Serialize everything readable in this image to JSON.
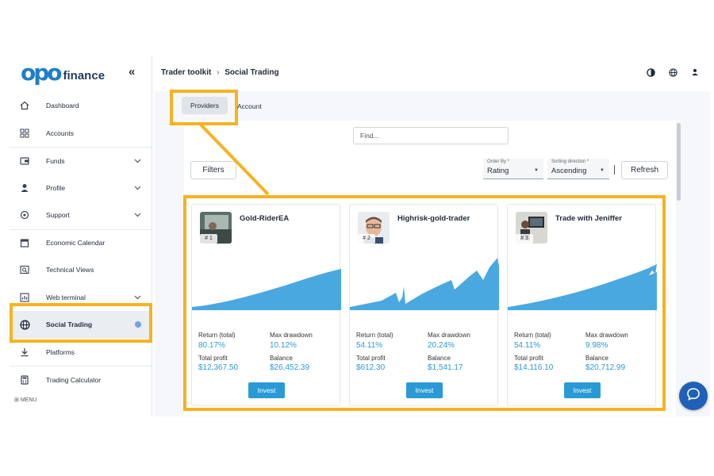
{
  "brand": {
    "mark": "opo",
    "text": "finance",
    "accent": "#1f7fc8",
    "highlight": "#f5b320"
  },
  "sidebar": {
    "items": [
      {
        "label": "Dashboard",
        "icon": "home-icon"
      },
      {
        "label": "Accounts",
        "icon": "grid-icon"
      },
      {
        "label": "Funds",
        "icon": "wallet-icon"
      },
      {
        "label": "Profile",
        "icon": "user-icon"
      },
      {
        "label": "Support",
        "icon": "support-icon"
      },
      {
        "label": "Economic Calendar",
        "icon": "calendar-icon"
      },
      {
        "label": "Technical Views",
        "icon": "search-chart-icon"
      },
      {
        "label": "Web terminal",
        "icon": "chart-icon"
      },
      {
        "label": "Social Trading",
        "icon": "globe-icon"
      },
      {
        "label": "Platforms",
        "icon": "download-icon"
      },
      {
        "label": "Trading Calculator",
        "icon": "calculator-icon"
      }
    ],
    "menu_label": "MENU"
  },
  "header": {
    "breadcrumb": [
      "Trader toolkit",
      "Social Trading"
    ]
  },
  "tabs": {
    "providers": "Providers",
    "account": "Account"
  },
  "toolbar": {
    "find_placeholder": "Find...",
    "filters": "Filters",
    "order_by_label": "Order By *",
    "order_by_value": "Rating",
    "sort_label": "Sorting direction *",
    "sort_value": "Ascending",
    "refresh": "Refresh"
  },
  "cards": [
    {
      "rank": "# 1",
      "name": "Gold-RiderEA",
      "return_label": "Return (total)",
      "return": "80.17%",
      "drawdown_label": "Max drawdown",
      "drawdown": "10.12%",
      "profit_label": "Total profit",
      "profit": "$12,367.50",
      "balance_label": "Balance",
      "balance": "$26,452.39",
      "invest": "Invest"
    },
    {
      "rank": "# 2",
      "name": "Highrisk-gold-trader",
      "return_label": "Return (total)",
      "return": "54.11%",
      "drawdown_label": "Max drawdown",
      "drawdown": "20.24%",
      "profit_label": "Total profit",
      "profit": "$612.30",
      "balance_label": "Balance",
      "balance": "$1,541.17",
      "invest": "Invest"
    },
    {
      "rank": "# 3",
      "name": "Trade with Jeniffer",
      "return_label": "Return (total)",
      "return": "54.11%",
      "drawdown_label": "Max drawdown",
      "drawdown": "9.98%",
      "profit_label": "Total profit",
      "profit": "$14,116.10",
      "balance_label": "Balance",
      "balance": "$20,712.99",
      "invest": "Invest"
    }
  ]
}
